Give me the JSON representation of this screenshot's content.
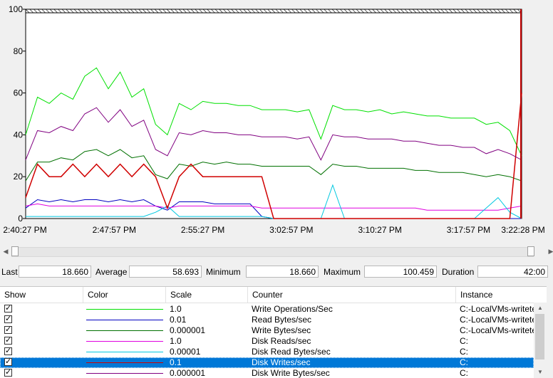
{
  "graph": {
    "y_ticks": [
      "0",
      "20",
      "40",
      "60",
      "80",
      "100"
    ],
    "x_ticks": [
      "2:40:27 PM",
      "2:47:57 PM",
      "2:55:27 PM",
      "3:02:57 PM",
      "3:10:27 PM",
      "3:17:57 PM",
      "3:22:28 PM"
    ]
  },
  "chart_data": {
    "type": "line",
    "ylim": [
      0,
      100
    ],
    "y_ticks": [
      0,
      20,
      40,
      60,
      80,
      100
    ],
    "x_ticks": [
      "2:40:27 PM",
      "2:47:57 PM",
      "2:55:27 PM",
      "3:02:57 PM",
      "3:10:27 PM",
      "3:17:57 PM",
      "3:22:28 PM"
    ],
    "xlim_minutes": [
      0,
      42
    ],
    "grid": false,
    "series": [
      {
        "name": "Write Operations/Sec",
        "color": "#00e000",
        "points": [
          [
            0,
            40
          ],
          [
            1,
            58
          ],
          [
            2,
            55
          ],
          [
            3,
            60
          ],
          [
            4,
            57
          ],
          [
            5,
            68
          ],
          [
            6,
            72
          ],
          [
            7,
            62
          ],
          [
            8,
            70
          ],
          [
            9,
            58
          ],
          [
            10,
            62
          ],
          [
            11,
            45
          ],
          [
            12,
            40
          ],
          [
            13,
            55
          ],
          [
            14,
            52
          ],
          [
            15,
            56
          ],
          [
            16,
            55
          ],
          [
            17,
            55
          ],
          [
            18,
            54
          ],
          [
            19,
            54
          ],
          [
            20,
            52
          ],
          [
            21,
            52
          ],
          [
            22,
            52
          ],
          [
            23,
            51
          ],
          [
            24,
            52
          ],
          [
            25,
            38
          ],
          [
            26,
            54
          ],
          [
            27,
            52
          ],
          [
            28,
            52
          ],
          [
            29,
            51
          ],
          [
            30,
            52
          ],
          [
            31,
            50
          ],
          [
            32,
            51
          ],
          [
            33,
            50
          ],
          [
            34,
            49
          ],
          [
            35,
            49
          ],
          [
            36,
            48
          ],
          [
            37,
            48
          ],
          [
            38,
            48
          ],
          [
            39,
            45
          ],
          [
            40,
            46
          ],
          [
            41,
            42
          ],
          [
            42,
            30
          ]
        ]
      },
      {
        "name": "Read Bytes/sec",
        "color": "#0000c0",
        "points": [
          [
            0,
            5
          ],
          [
            1,
            9
          ],
          [
            2,
            8
          ],
          [
            3,
            9
          ],
          [
            4,
            8
          ],
          [
            5,
            9
          ],
          [
            6,
            9
          ],
          [
            7,
            8
          ],
          [
            8,
            9
          ],
          [
            9,
            8
          ],
          [
            10,
            9
          ],
          [
            11,
            6
          ],
          [
            12,
            4
          ],
          [
            13,
            8
          ],
          [
            14,
            8
          ],
          [
            15,
            8
          ],
          [
            16,
            7
          ],
          [
            17,
            7
          ],
          [
            18,
            7
          ],
          [
            19,
            7
          ],
          [
            20,
            1
          ],
          [
            21,
            0
          ],
          [
            22,
            0
          ],
          [
            23,
            0
          ],
          [
            24,
            0
          ],
          [
            25,
            0
          ],
          [
            26,
            0
          ],
          [
            27,
            0
          ],
          [
            28,
            0
          ],
          [
            29,
            0
          ],
          [
            30,
            0
          ],
          [
            31,
            0
          ],
          [
            32,
            0
          ],
          [
            33,
            0
          ],
          [
            34,
            0
          ],
          [
            35,
            0
          ],
          [
            36,
            0
          ],
          [
            37,
            0
          ],
          [
            38,
            0
          ],
          [
            39,
            0
          ],
          [
            40,
            0
          ],
          [
            41,
            0
          ],
          [
            42,
            0
          ]
        ]
      },
      {
        "name": "Write Bytes/sec",
        "color": "#007000",
        "points": [
          [
            0,
            18
          ],
          [
            1,
            27
          ],
          [
            2,
            27
          ],
          [
            3,
            29
          ],
          [
            4,
            28
          ],
          [
            5,
            32
          ],
          [
            6,
            33
          ],
          [
            7,
            30
          ],
          [
            8,
            33
          ],
          [
            9,
            29
          ],
          [
            10,
            30
          ],
          [
            11,
            21
          ],
          [
            12,
            19
          ],
          [
            13,
            26
          ],
          [
            14,
            25
          ],
          [
            15,
            27
          ],
          [
            16,
            26
          ],
          [
            17,
            27
          ],
          [
            18,
            26
          ],
          [
            19,
            26
          ],
          [
            20,
            25
          ],
          [
            21,
            25
          ],
          [
            22,
            25
          ],
          [
            23,
            25
          ],
          [
            24,
            25
          ],
          [
            25,
            21
          ],
          [
            26,
            26
          ],
          [
            27,
            25
          ],
          [
            28,
            25
          ],
          [
            29,
            24
          ],
          [
            30,
            24
          ],
          [
            31,
            24
          ],
          [
            32,
            24
          ],
          [
            33,
            23
          ],
          [
            34,
            23
          ],
          [
            35,
            22
          ],
          [
            36,
            22
          ],
          [
            37,
            22
          ],
          [
            38,
            21
          ],
          [
            39,
            20
          ],
          [
            40,
            21
          ],
          [
            41,
            20
          ],
          [
            42,
            18
          ]
        ]
      },
      {
        "name": "Disk Reads/sec",
        "color": "#e000e0",
        "points": [
          [
            0,
            6
          ],
          [
            1,
            7
          ],
          [
            2,
            6
          ],
          [
            3,
            6
          ],
          [
            4,
            6
          ],
          [
            5,
            6
          ],
          [
            6,
            6
          ],
          [
            7,
            6
          ],
          [
            8,
            6
          ],
          [
            9,
            6
          ],
          [
            10,
            6
          ],
          [
            11,
            6
          ],
          [
            12,
            5
          ],
          [
            13,
            6
          ],
          [
            14,
            6
          ],
          [
            15,
            6
          ],
          [
            16,
            6
          ],
          [
            17,
            6
          ],
          [
            18,
            6
          ],
          [
            19,
            6
          ],
          [
            20,
            5
          ],
          [
            21,
            5
          ],
          [
            22,
            5
          ],
          [
            23,
            5
          ],
          [
            24,
            5
          ],
          [
            25,
            5
          ],
          [
            26,
            5
          ],
          [
            27,
            5
          ],
          [
            28,
            5
          ],
          [
            29,
            5
          ],
          [
            30,
            5
          ],
          [
            31,
            5
          ],
          [
            32,
            5
          ],
          [
            33,
            5
          ],
          [
            34,
            4
          ],
          [
            35,
            4
          ],
          [
            36,
            4
          ],
          [
            37,
            4
          ],
          [
            38,
            4
          ],
          [
            39,
            4
          ],
          [
            40,
            4
          ],
          [
            41,
            5
          ],
          [
            42,
            6
          ]
        ]
      },
      {
        "name": "Disk Read Bytes/sec",
        "color": "#00c8e0",
        "points": [
          [
            0,
            1
          ],
          [
            2,
            1
          ],
          [
            4,
            1
          ],
          [
            6,
            1
          ],
          [
            8,
            1
          ],
          [
            10,
            1
          ],
          [
            11,
            3
          ],
          [
            12,
            6
          ],
          [
            13,
            1
          ],
          [
            16,
            1
          ],
          [
            20,
            1
          ],
          [
            21,
            0
          ],
          [
            25,
            0
          ],
          [
            26,
            16
          ],
          [
            27,
            0
          ],
          [
            38,
            0
          ],
          [
            39,
            5
          ],
          [
            40,
            10
          ],
          [
            41,
            3
          ],
          [
            42,
            0
          ]
        ]
      },
      {
        "name": "Disk Writes/sec",
        "color": "#d00000",
        "points": [
          [
            0,
            10
          ],
          [
            1,
            26
          ],
          [
            2,
            20
          ],
          [
            3,
            20
          ],
          [
            4,
            26
          ],
          [
            5,
            20
          ],
          [
            6,
            26
          ],
          [
            7,
            20
          ],
          [
            8,
            26
          ],
          [
            9,
            20
          ],
          [
            10,
            26
          ],
          [
            11,
            20
          ],
          [
            12,
            5
          ],
          [
            13,
            20
          ],
          [
            14,
            26
          ],
          [
            15,
            20
          ],
          [
            16,
            20
          ],
          [
            17,
            20
          ],
          [
            18,
            20
          ],
          [
            19,
            20
          ],
          [
            20,
            20
          ],
          [
            21,
            0
          ],
          [
            25,
            0
          ],
          [
            26,
            0
          ],
          [
            30,
            0
          ],
          [
            38,
            0
          ],
          [
            40,
            0
          ],
          [
            41,
            0
          ],
          [
            42,
            60
          ]
        ]
      },
      {
        "name": "Disk Write Bytes/sec",
        "color": "#800080",
        "points": [
          [
            0,
            28
          ],
          [
            1,
            42
          ],
          [
            2,
            41
          ],
          [
            3,
            44
          ],
          [
            4,
            42
          ],
          [
            5,
            50
          ],
          [
            6,
            53
          ],
          [
            7,
            46
          ],
          [
            8,
            52
          ],
          [
            9,
            44
          ],
          [
            10,
            47
          ],
          [
            11,
            33
          ],
          [
            12,
            30
          ],
          [
            13,
            41
          ],
          [
            14,
            40
          ],
          [
            15,
            42
          ],
          [
            16,
            41
          ],
          [
            17,
            41
          ],
          [
            18,
            40
          ],
          [
            19,
            40
          ],
          [
            20,
            39
          ],
          [
            21,
            39
          ],
          [
            22,
            39
          ],
          [
            23,
            38
          ],
          [
            24,
            39
          ],
          [
            25,
            28
          ],
          [
            26,
            40
          ],
          [
            27,
            39
          ],
          [
            28,
            39
          ],
          [
            29,
            38
          ],
          [
            30,
            38
          ],
          [
            31,
            38
          ],
          [
            32,
            37
          ],
          [
            33,
            37
          ],
          [
            34,
            36
          ],
          [
            35,
            35
          ],
          [
            36,
            35
          ],
          [
            37,
            34
          ],
          [
            38,
            34
          ],
          [
            39,
            31
          ],
          [
            40,
            33
          ],
          [
            41,
            31
          ],
          [
            42,
            28
          ]
        ]
      }
    ]
  },
  "stats": {
    "last_label": "Last",
    "last_value": "18.660",
    "average_label": "Average",
    "average_value": "58.693",
    "minimum_label": "Minimum",
    "minimum_value": "18.660",
    "maximum_label": "Maximum",
    "maximum_value": "100.459",
    "duration_label": "Duration",
    "duration_value": "42:00"
  },
  "table": {
    "headers": {
      "show": "Show",
      "color": "Color",
      "scale": "Scale",
      "counter": "Counter",
      "instance": "Instance"
    },
    "rows": [
      {
        "checked": "✓",
        "color": "#00e000",
        "scale": "1.0",
        "counter": "Write Operations/Sec",
        "instance": "C:-LocalVMs-writetest"
      },
      {
        "checked": "✓",
        "color": "#0000c0",
        "scale": "0.01",
        "counter": "Read Bytes/sec",
        "instance": "C:-LocalVMs-writetest"
      },
      {
        "checked": "✓",
        "color": "#007000",
        "scale": "0.000001",
        "counter": "Write Bytes/sec",
        "instance": "C:-LocalVMs-writetest"
      },
      {
        "checked": "✓",
        "color": "#e000e0",
        "scale": "1.0",
        "counter": "Disk Reads/sec",
        "instance": "C:"
      },
      {
        "checked": "✓",
        "color": "#00c8e0",
        "scale": "0.00001",
        "counter": "Disk Read Bytes/sec",
        "instance": "C:"
      },
      {
        "checked": "✓",
        "color": "#d00000",
        "scale": "0.1",
        "counter": "Disk Writes/sec",
        "instance": "C:",
        "selected": true
      },
      {
        "checked": "✓",
        "color": "#800080",
        "scale": "0.000001",
        "counter": "Disk Write Bytes/sec",
        "instance": "C:"
      }
    ]
  }
}
